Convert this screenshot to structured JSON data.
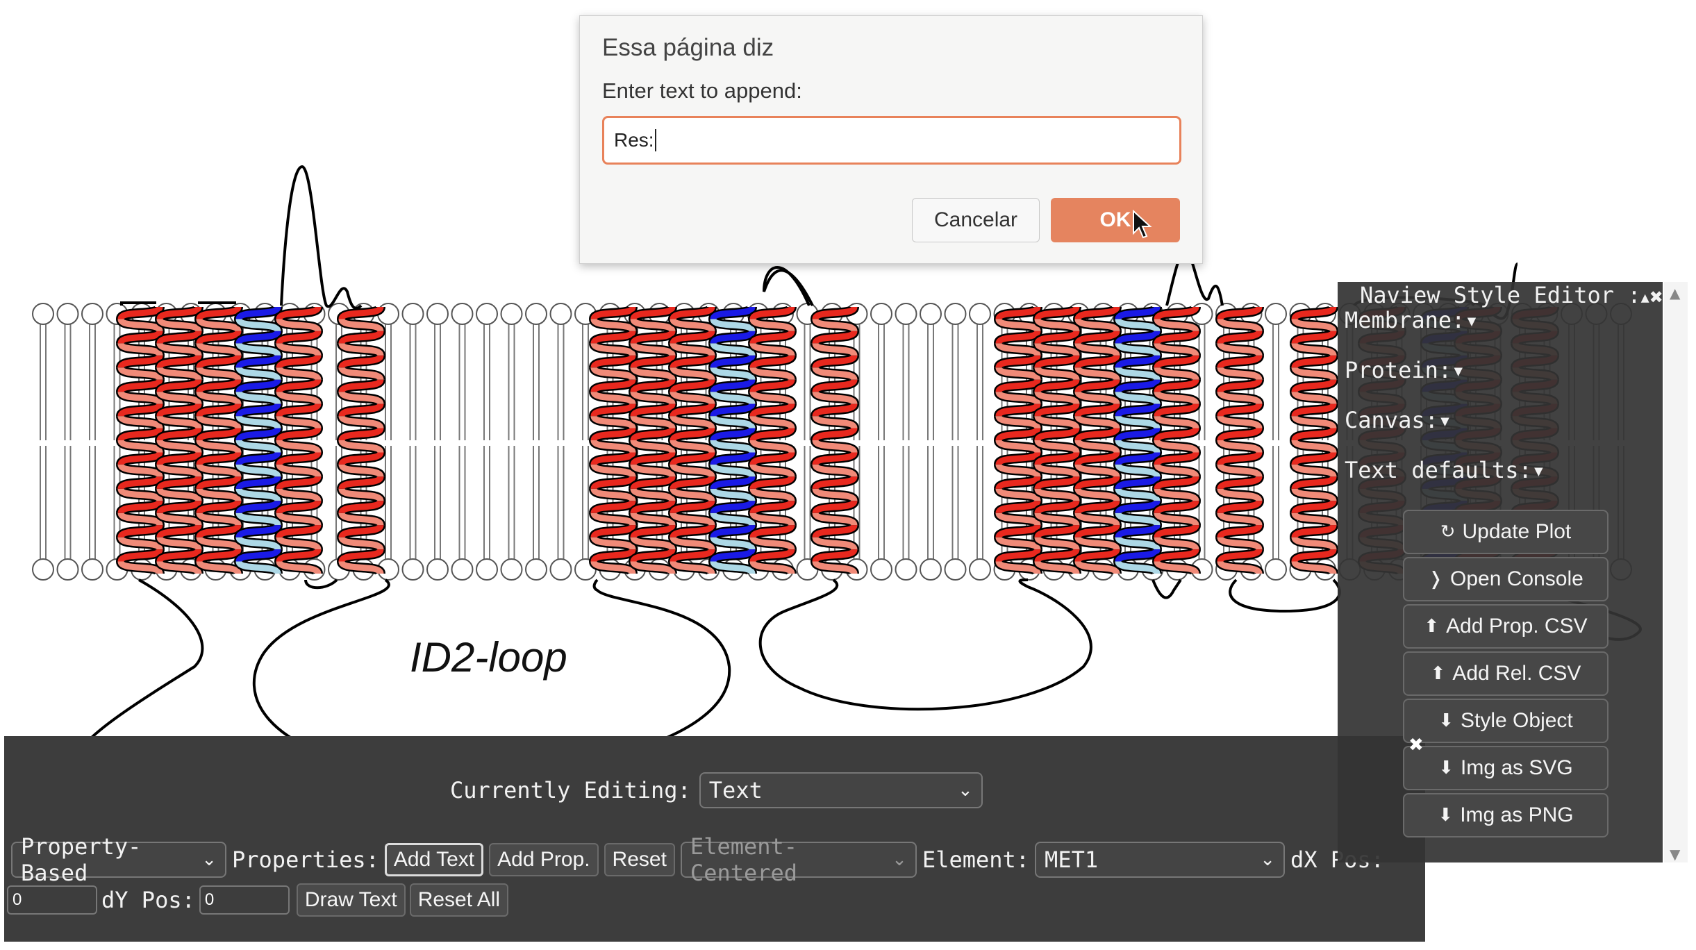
{
  "dialog": {
    "title": "Essa página diz",
    "message": "Enter text to append:",
    "input_value": "Res:",
    "cancel_label": "Cancelar",
    "ok_label": "OK",
    "accent_color": "#e5845f"
  },
  "diagram": {
    "loop_label": "ID2-loop",
    "helix_colors": {
      "red": "#e8281e",
      "salmon": "#f08a78",
      "blue": "#1a1ae6",
      "light_blue": "#add8e6"
    }
  },
  "bottom_panel": {
    "currently_editing_label": "Currently Editing:",
    "currently_editing_value": "Text",
    "mode_select": "Property-Based",
    "properties_label": "Properties:",
    "add_text_label": "Add Text",
    "add_prop_label": "Add Prop.",
    "reset_label": "Reset",
    "centering_select": "Element-Centered",
    "element_label": "Element:",
    "element_value": "MET1",
    "dx_label": "dX Pos:",
    "dx_value": "0",
    "dy_label": "dY Pos:",
    "dy_value": "0",
    "draw_text_label": "Draw Text",
    "reset_all_label": "Reset All",
    "close_icon": "close-icon"
  },
  "style_editor": {
    "title": "Naview Style Editor :",
    "controls": "▴✖",
    "sections": [
      "Membrane:▾",
      "Protein:▾",
      "Canvas:▾",
      "Text defaults:▾"
    ],
    "buttons": [
      {
        "icon": "↻",
        "label": "Update Plot"
      },
      {
        "icon": "❭",
        "label": "Open Console"
      },
      {
        "icon": "⬆",
        "label": "Add Prop. CSV"
      },
      {
        "icon": "⬆",
        "label": "Add Rel. CSV"
      },
      {
        "icon": "⬇",
        "label": "Style Object"
      },
      {
        "icon": "⬇",
        "label": "Img as SVG"
      },
      {
        "icon": "⬇",
        "label": "Img as PNG"
      }
    ]
  }
}
